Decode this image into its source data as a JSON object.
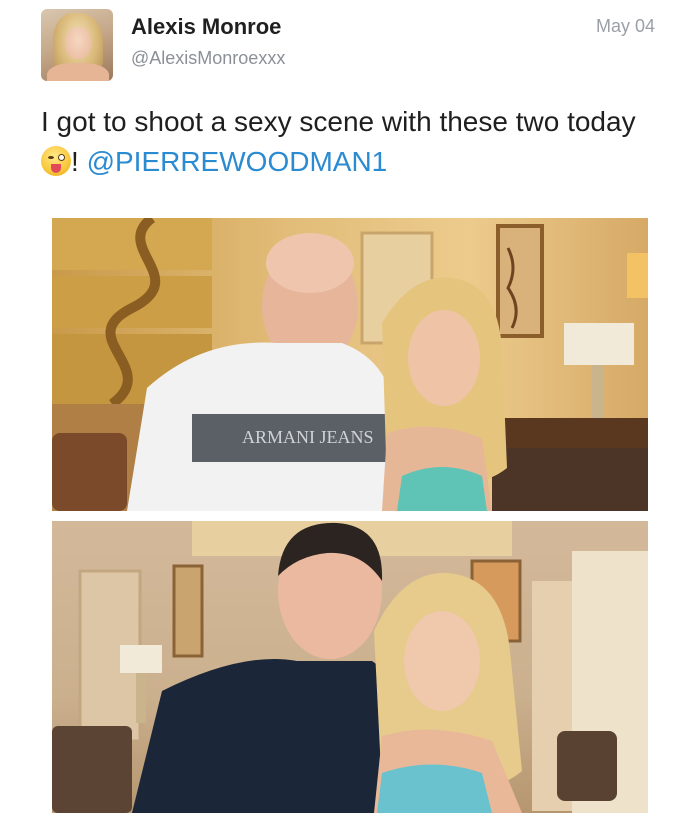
{
  "tweet": {
    "author_name": "Alexis Monroe",
    "author_handle": "@AlexisMonroexxx",
    "date": "May 04",
    "text_before_emoji": "I got to shoot a sexy scene with these two today ",
    "text_after_emoji": "! ",
    "mention": "@PIERREWOODMAN1",
    "emoji": "winking-face-with-tongue-emoji"
  },
  "photos": [
    {
      "shirt_print": "ARMANI JEANS"
    },
    {
      "shirt_print": ""
    }
  ]
}
